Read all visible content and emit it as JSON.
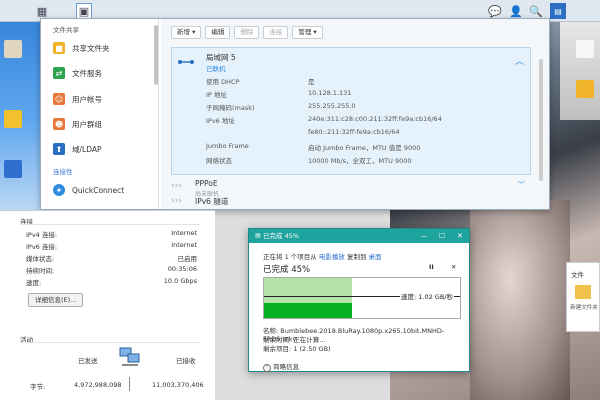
{
  "main": {
    "sidebar": {
      "section1": "文件共享",
      "items": [
        {
          "label": "共享文件夹",
          "icon": "folder-icon",
          "color": "#f0b429"
        },
        {
          "label": "文件服务",
          "icon": "file-services-icon",
          "color": "#2ea44f"
        },
        {
          "label": "用户帐号",
          "icon": "user-icon",
          "color": "#e8773c"
        },
        {
          "label": "用户群组",
          "icon": "group-icon",
          "color": "#e8773c"
        },
        {
          "label": "域/LDAP",
          "icon": "domain-icon",
          "color": "#2a6fc4"
        }
      ],
      "section2": "连接性",
      "quickconnect": {
        "label": "QuickConnect",
        "icon": "quickconnect-icon",
        "color": "#2e8be0"
      }
    },
    "toolbar": {
      "create": "新增 ▾",
      "edit": "编辑",
      "delete": "删除",
      "connect": "连接",
      "manage": "管理 ▾"
    },
    "network": {
      "name": "局域网 5",
      "status": "已联机",
      "rows": [
        {
          "k": "使用 DHCP",
          "v": "是"
        },
        {
          "k": "IP 地址",
          "v": "10.128.1.131"
        },
        {
          "k": "子网掩码(mask)",
          "v": "255.255.255.0"
        },
        {
          "k": "IPv6 地址",
          "v": "240e:311:c28:c00:211:32ff:fe9a:cb16/64"
        },
        {
          "k": "",
          "v": "fe80::211:32ff:fe9a:cb16/64"
        },
        {
          "k": "Jumbo Frame",
          "v": "启动 Jumbo Frame，MTU 值是 9000"
        },
        {
          "k": "网络状态",
          "v": "10000 Mb/s，全双工，MTU 9000"
        }
      ]
    },
    "pppoe": {
      "name": "PPPoE",
      "status": "尚未联机"
    },
    "ipv6tunnel": {
      "name": "IPv6 隧道"
    }
  },
  "details": {
    "section": "连接",
    "rows": [
      {
        "k": "IPv4 连接:",
        "v": "Internet"
      },
      {
        "k": "IPv6 连接:",
        "v": "Internet"
      },
      {
        "k": "媒体状态:",
        "v": "已启用"
      },
      {
        "k": "持续时间:",
        "v": "00:35:06"
      },
      {
        "k": "速度:",
        "v": "10.0 Gbps"
      }
    ],
    "details_button": "详细信息(E)...",
    "activity": "活动",
    "sent_label": "已发送",
    "received_label": "已接收",
    "bytes_label": "字节:",
    "sent_bytes": "4,972,988,098",
    "received_bytes": "11,003,370,406"
  },
  "copy_dialog": {
    "title": "已完成 45%",
    "line1_prefix": "正在将 1 个项目从",
    "line1_src": "电影播放",
    "line1_mid": "复制到",
    "line1_dst": "桌面",
    "percent_label": "已完成 45%",
    "pause": "II",
    "cancel": "✕",
    "speed": "速度: 1.02 GB/秒",
    "progress": 0.45,
    "name_line": "名称: Bumblebee.2018.BluRay.1080p.x265.10bit.MNHD-FRDS.mkv",
    "time_line": "剩余时间: 正在计算...",
    "items_line": "剩余项目: 1 (2.50 GB)",
    "fewer": "简略信息"
  },
  "right_card": {
    "label": "文件",
    "sub": "新建文件夹"
  }
}
